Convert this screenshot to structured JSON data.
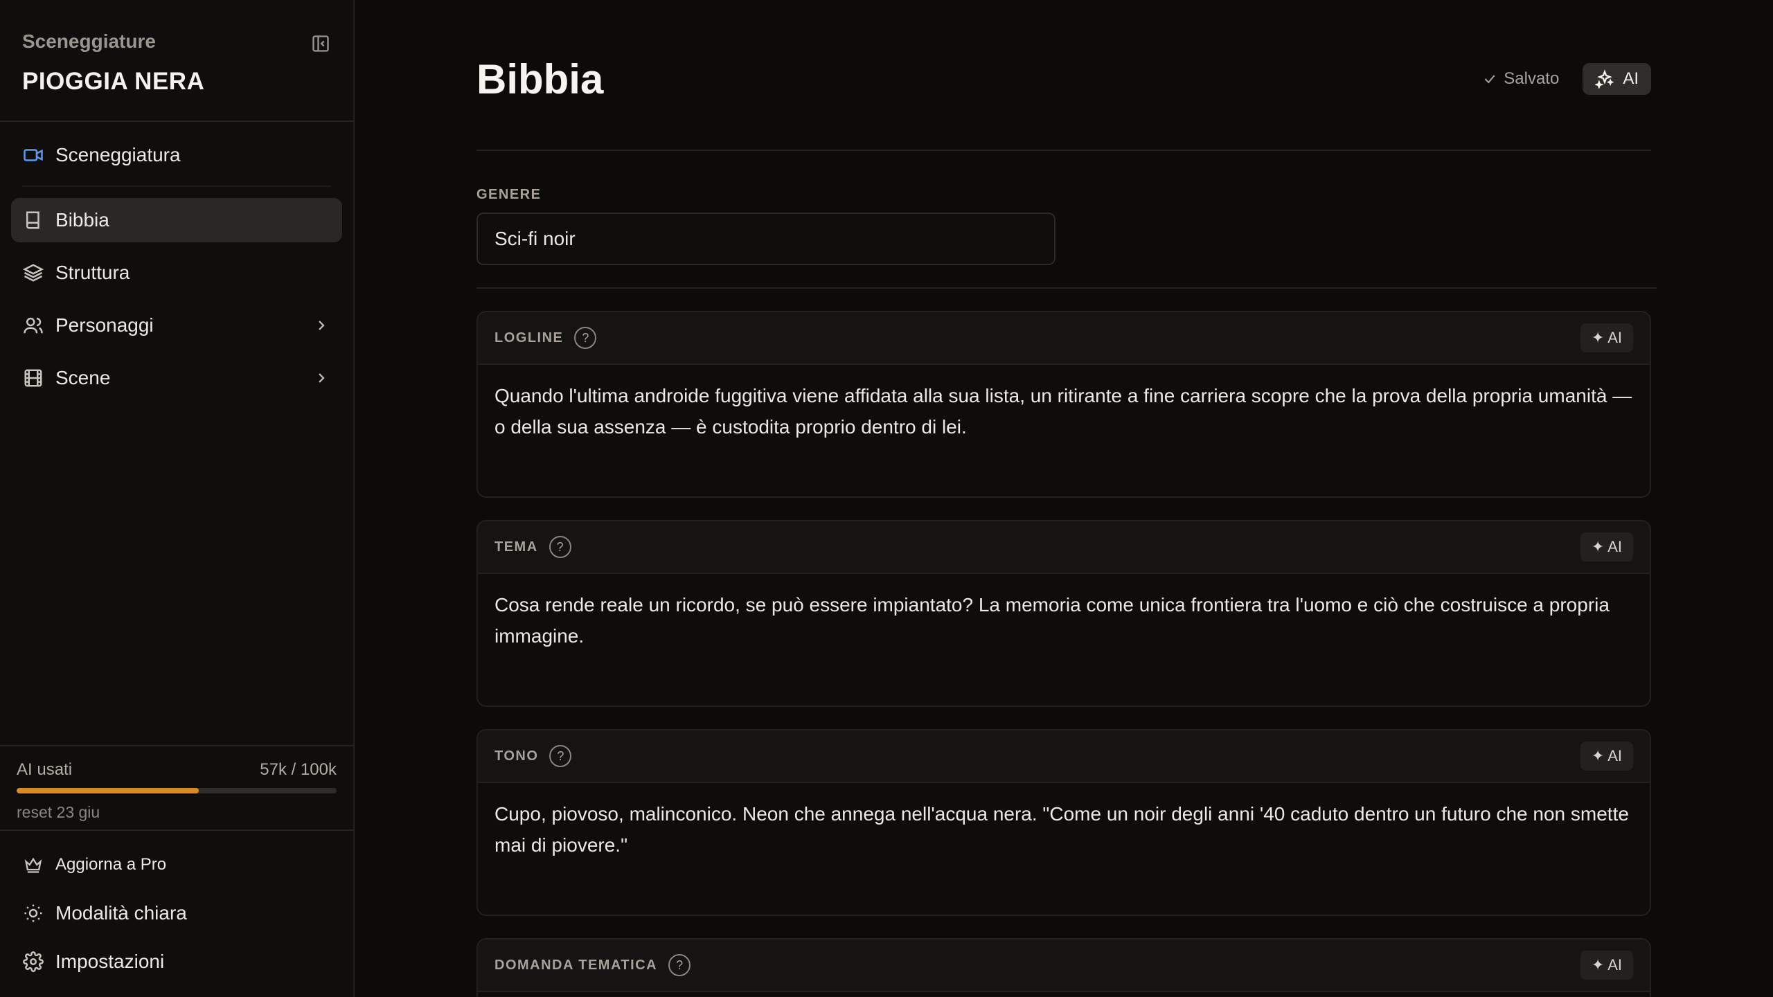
{
  "sidebar": {
    "app_name": "Sceneggiature",
    "project_name": "PIOGGIA NERA",
    "nav": [
      {
        "label": "Sceneggiatura",
        "icon": "video-camera-icon"
      },
      {
        "label": "Bibbia",
        "icon": "book-icon",
        "active": true
      },
      {
        "label": "Struttura",
        "icon": "layers-icon"
      },
      {
        "label": "Personaggi",
        "icon": "users-icon",
        "expandable": true
      },
      {
        "label": "Scene",
        "icon": "film-icon",
        "expandable": true
      }
    ],
    "usage": {
      "label": "AI usati",
      "value": "57k / 100k",
      "progress": 0.57,
      "reset": "reset 23 giu"
    },
    "bottom": [
      {
        "label": "Aggiorna a Pro",
        "icon": "crown-icon"
      },
      {
        "label": "Modalità chiara",
        "icon": "sun-icon"
      },
      {
        "label": "Impostazioni",
        "icon": "gear-icon"
      }
    ]
  },
  "main": {
    "title": "Bibbia",
    "saved_label": "Salvato",
    "ai_button": "AI",
    "genre": {
      "label": "GENERE",
      "value": "Sci-fi noir"
    },
    "sections": [
      {
        "label": "LOGLINE",
        "ai": "✦ AI",
        "text": "Quando l'ultima androide fuggitiva viene affidata alla sua lista, un ritirante a fine carriera scopre che la prova della propria umanità — o della sua assenza — è custodita proprio dentro di lei."
      },
      {
        "label": "TEMA",
        "ai": "✦ AI",
        "text": "Cosa rende reale un ricordo, se può essere impiantato? La memoria come unica frontiera tra l'uomo e ciò che costruisce a propria immagine."
      },
      {
        "label": "TONO",
        "ai": "✦ AI",
        "text": "Cupo, piovoso, malinconico. Neon che annega nell'acqua nera. \"Come un noir degli anni '40 caduto dentro un futuro che non smette mai di piovere.\""
      },
      {
        "label": "DOMANDA TEMATICA",
        "ai": "✦ AI",
        "text": ""
      }
    ]
  },
  "colors": {
    "background": "#0c0b0a",
    "sidebar": "#0f0e0c",
    "accent_usage": "#d98a24",
    "camera_icon": "#5b9cf0"
  }
}
